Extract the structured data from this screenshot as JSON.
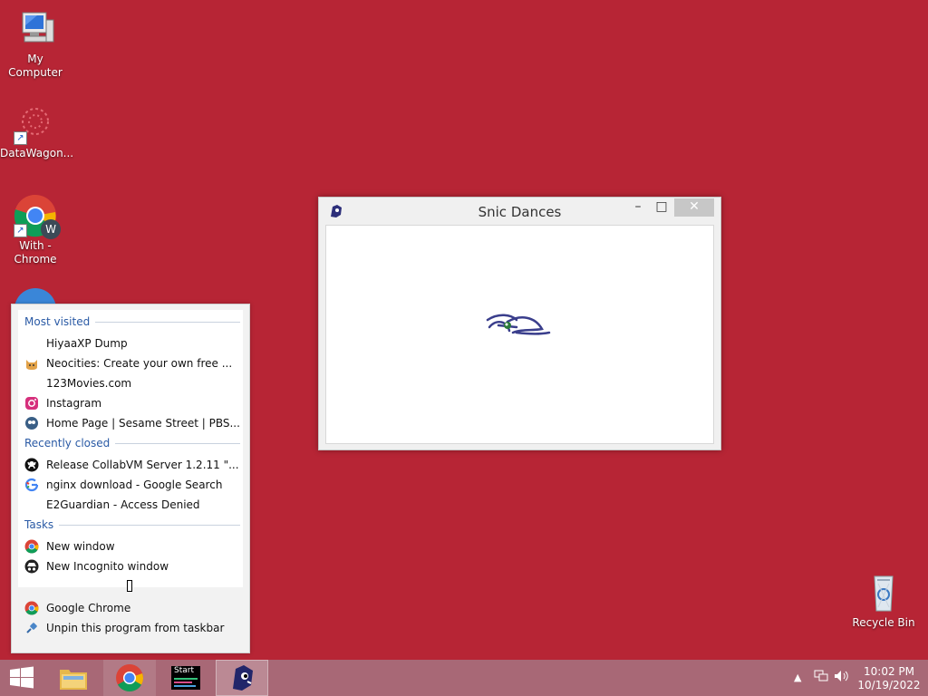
{
  "desktop": {
    "icons": [
      {
        "label": "My Computer"
      },
      {
        "label": "DataWagon..."
      },
      {
        "label_line1": "With -",
        "label_line2": "Chrome",
        "badge": "W"
      },
      {
        "label": "Recycle Bin"
      }
    ]
  },
  "window": {
    "title": "Snic Dances",
    "minimize": "–",
    "maximize": "□",
    "close": "✕"
  },
  "jumplist": {
    "most_visited_header": "Most visited",
    "most_visited": [
      {
        "label": "HiyaaXP Dump",
        "icon": "none"
      },
      {
        "label": "Neocities: Create your own free ...",
        "icon": "cat-favicon"
      },
      {
        "label": "123Movies.com",
        "icon": "none"
      },
      {
        "label": "Instagram",
        "icon": "instagram-favicon"
      },
      {
        "label": "Home Page | Sesame Street | PBS...",
        "icon": "pbs-favicon"
      }
    ],
    "recently_closed_header": "Recently closed",
    "recently_closed": [
      {
        "label": "Release CollabVM Server 1.2.11 \"...",
        "icon": "github-favicon"
      },
      {
        "label": "nginx download - Google Search",
        "icon": "google-favicon"
      },
      {
        "label": "E2Guardian - Access Denied",
        "icon": "none"
      }
    ],
    "tasks_header": "Tasks",
    "tasks": [
      {
        "label": "New window",
        "icon": "chrome-icon"
      },
      {
        "label": "New Incognito window",
        "icon": "incognito-icon"
      }
    ],
    "bottom": [
      {
        "label": "Google Chrome",
        "icon": "chrome-icon"
      },
      {
        "label": "Unpin this program from taskbar",
        "icon": "unpin-icon"
      }
    ]
  },
  "taskbar": {
    "start_tile_label": "Start",
    "clock_time": "10:02 PM",
    "clock_date": "10/19/2022"
  },
  "colors": {
    "desktop": "#b72535",
    "taskbar": "#a86876",
    "section_header": "#2a5aa5"
  }
}
